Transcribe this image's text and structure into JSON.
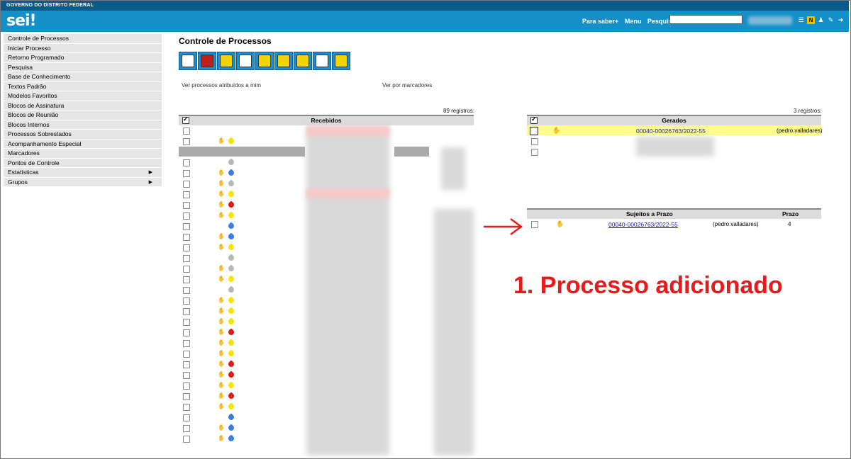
{
  "gov_bar": "GOVERNO DO DISTRITO FEDERAL",
  "logo": "sei!",
  "header": {
    "links": [
      "Para saber+",
      "Menu",
      "Pesquisa"
    ],
    "search_value": ""
  },
  "sidebar": {
    "items": [
      {
        "label": "Controle de Processos",
        "arrow": false
      },
      {
        "label": "Iniciar Processo",
        "arrow": false
      },
      {
        "label": "Retorno Programado",
        "arrow": false
      },
      {
        "label": "Pesquisa",
        "arrow": false
      },
      {
        "label": "Base de Conhecimento",
        "arrow": false
      },
      {
        "label": "Textos Padrão",
        "arrow": false
      },
      {
        "label": "Modelos Favoritos",
        "arrow": false
      },
      {
        "label": "Blocos de Assinatura",
        "arrow": false
      },
      {
        "label": "Blocos de Reunião",
        "arrow": false
      },
      {
        "label": "Blocos Internos",
        "arrow": false
      },
      {
        "label": "Processos Sobrestados",
        "arrow": false
      },
      {
        "label": "Acompanhamento Especial",
        "arrow": false
      },
      {
        "label": "Marcadores",
        "arrow": false
      },
      {
        "label": "Pontos de Controle",
        "arrow": false
      },
      {
        "label": "Estatísticas",
        "arrow": true
      },
      {
        "label": "Grupos",
        "arrow": true
      }
    ]
  },
  "main": {
    "title": "Controle de Processos",
    "toolbar_icons": [
      "send-process-icon",
      "users-icon",
      "assign-icon",
      "books-icon",
      "pause-icon",
      "map-icon",
      "note-icon",
      "new-document-icon",
      "tag-icon"
    ],
    "link_assigned": "Ver processos atribuídos a mim",
    "link_markers": "Ver por marcadores"
  },
  "received": {
    "count": "89 registros:",
    "header": "Recebidos",
    "marker_rows": [
      [],
      [
        "#f5e400"
      ],
      [],
      [
        "#b8b8b8"
      ],
      [
        "#3a7fe0"
      ],
      [
        "#b8b8b8"
      ],
      [
        "#f5e400"
      ],
      [
        "#e01818"
      ],
      [
        "#f5e400"
      ],
      [
        "#3a7fe0"
      ],
      [
        "#3a7fe0"
      ],
      [
        "#f5e400"
      ],
      [
        "#b8b8b8"
      ],
      [
        "#b8b8b8"
      ],
      [
        "#f5e400"
      ],
      [
        "#b8b8b8"
      ],
      [
        "#f5e400"
      ],
      [
        "#f5e400"
      ],
      [
        "#f5e400"
      ],
      [
        "#e01818"
      ],
      [
        "#f5e400"
      ],
      [
        "#f5e400"
      ],
      [
        "#e01818"
      ],
      [
        "#e01818"
      ],
      [
        "#f5e400"
      ],
      [
        "#e01818"
      ],
      [
        "#f5e400"
      ],
      [
        "#3a7fe0"
      ],
      [
        "#3a7fe0"
      ],
      [
        "#3a7fe0"
      ]
    ]
  },
  "generated": {
    "count": "3 registros:",
    "header": "Gerados",
    "first_process": "00040-00026763/2022-55",
    "first_user": "(pedro.valladares)"
  },
  "deadline": {
    "header_subjects": "Sujeitos a Prazo",
    "header_deadline": "Prazo",
    "process": "00040-00026763/2022-55",
    "user": "(pedro.valladares)",
    "deadline_value": "4"
  },
  "annotation": "1. Processo adicionado",
  "colors": {
    "header_blue": "#1490c8",
    "highlight": "#fffd8c",
    "annotation_red": "#e31d1d"
  }
}
